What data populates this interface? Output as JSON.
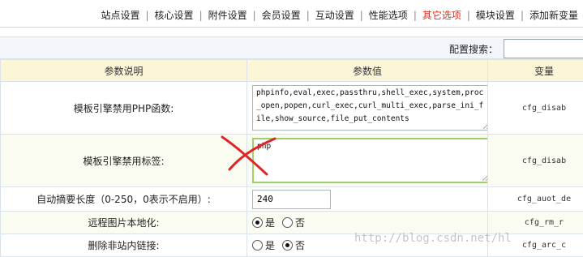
{
  "nav": {
    "items": [
      {
        "label": "站点设置",
        "active": false
      },
      {
        "label": "核心设置",
        "active": false
      },
      {
        "label": "附件设置",
        "active": false
      },
      {
        "label": "会员设置",
        "active": false
      },
      {
        "label": "互动设置",
        "active": false
      },
      {
        "label": "性能选项",
        "active": false
      },
      {
        "label": "其它选项",
        "active": true
      },
      {
        "label": "模块设置",
        "active": false
      },
      {
        "label": "添加新变量",
        "active": false
      }
    ],
    "separator": "|",
    "active_color": "#d8321f"
  },
  "search": {
    "label": "配置搜索：",
    "value": ""
  },
  "table": {
    "headers": [
      "参数说明",
      "参数值",
      "变量"
    ],
    "rows": [
      {
        "desc": "模板引擎禁用PHP函数:",
        "value": "phpinfo,eval,exec,passthru,shell_exec,system,proc_open,popen,curl_exec,curl_multi_exec,parse_ini_file,show_source,file_put_contents",
        "var": "cfg_disab"
      },
      {
        "desc": "模板引擎禁用标签:",
        "value": "php",
        "var": "cfg_disab"
      },
      {
        "desc": "自动摘要长度（0-250，0表示不启用）:",
        "value": "240",
        "var": "cfg_auot_de"
      },
      {
        "desc": "远程图片本地化:",
        "options": [
          "是",
          "否"
        ],
        "selected": "是",
        "var": "cfg_rm_r"
      },
      {
        "desc": "删除非站内链接:",
        "options": [
          "是",
          "否"
        ],
        "selected": "否",
        "var": "cfg_arc_c"
      }
    ]
  },
  "watermark": "http://blog.csdn.net/hl",
  "colors": {
    "header_bg": "#fcf6d8",
    "highlight_border": "#9ed06b",
    "annotation": "#e0252a"
  }
}
